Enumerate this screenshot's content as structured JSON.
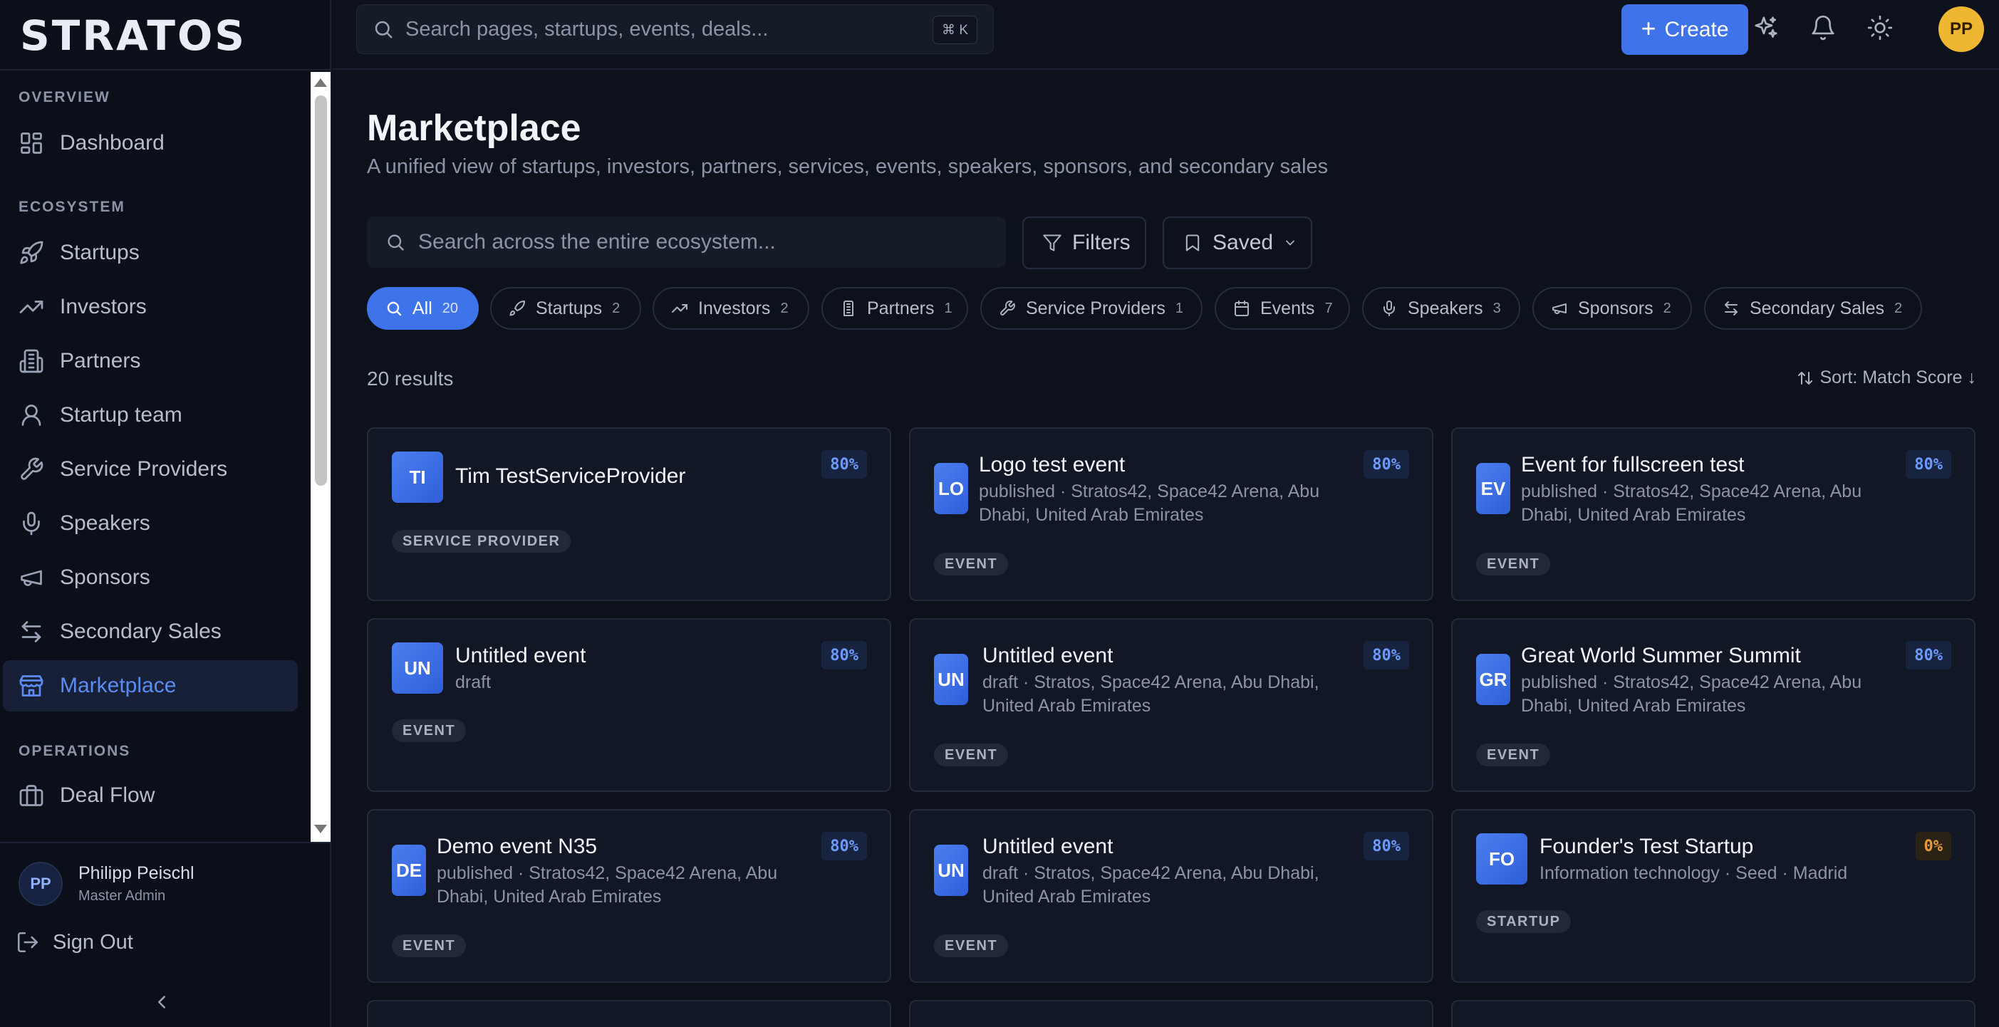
{
  "app": {
    "logo": "STRATOS"
  },
  "sidebar": {
    "sections": {
      "overview": "OVERVIEW",
      "ecosystem": "ECOSYSTEM",
      "operations": "OPERATIONS"
    },
    "items": [
      {
        "label": "Dashboard",
        "icon": "dashboard-icon"
      },
      {
        "label": "Startups",
        "icon": "rocket-icon"
      },
      {
        "label": "Investors",
        "icon": "trending-up-icon"
      },
      {
        "label": "Partners",
        "icon": "building-icon"
      },
      {
        "label": "Startup team",
        "icon": "user-icon"
      },
      {
        "label": "Service Providers",
        "icon": "wrench-icon"
      },
      {
        "label": "Speakers",
        "icon": "mic-icon"
      },
      {
        "label": "Sponsors",
        "icon": "megaphone-icon"
      },
      {
        "label": "Secondary Sales",
        "icon": "swap-icon"
      },
      {
        "label": "Marketplace",
        "icon": "store-icon",
        "active": true
      },
      {
        "label": "Deal Flow",
        "icon": "briefcase-icon"
      }
    ],
    "user": {
      "initials": "PP",
      "name": "Philipp Peischl",
      "role": "Master Admin"
    },
    "sign_out": "Sign Out"
  },
  "topbar": {
    "search_placeholder": "Search pages, startups, events, deals...",
    "shortcut": "⌘ K",
    "create_label": "Create",
    "avatar_initials": "PP"
  },
  "main": {
    "title": "Marketplace",
    "subtitle": "A unified view of startups, investors, partners, services, events, speakers, sponsors, and secondary sales",
    "search_placeholder": "Search across the entire ecosystem...",
    "filters_label": "Filters",
    "saved_label": "Saved",
    "chips": [
      {
        "label": "All",
        "count": "20",
        "active": true
      },
      {
        "label": "Startups",
        "count": "2"
      },
      {
        "label": "Investors",
        "count": "2"
      },
      {
        "label": "Partners",
        "count": "1"
      },
      {
        "label": "Service Providers",
        "count": "1"
      },
      {
        "label": "Events",
        "count": "7"
      },
      {
        "label": "Speakers",
        "count": "3"
      },
      {
        "label": "Sponsors",
        "count": "2"
      },
      {
        "label": "Secondary Sales",
        "count": "2"
      }
    ],
    "results_count": "20 results",
    "sort_label": "Sort: Match Score ↓",
    "cards": [
      {
        "initials": "TI",
        "title": "Tim TestServiceProvider",
        "meta_1": "",
        "meta_2": "",
        "score": "80%",
        "tag": "SERVICE PROVIDER"
      },
      {
        "initials": "LO",
        "title": "Logo test event",
        "meta_1": "published · Stratos42, Space42 Arena, Abu",
        "meta_2": "Dhabi, United Arab Emirates",
        "score": "80%",
        "tag": "EVENT"
      },
      {
        "initials": "EV",
        "title": "Event for fullscreen test",
        "meta_1": "published · Stratos42, Space42 Arena, Abu",
        "meta_2": "Dhabi, United Arab Emirates",
        "score": "80%",
        "tag": "EVENT"
      },
      {
        "initials": "UN",
        "title": "Untitled event",
        "meta_1": "draft",
        "meta_2": "",
        "score": "80%",
        "tag": "EVENT"
      },
      {
        "initials": "UN",
        "title": "Untitled event",
        "meta_1": "draft · Stratos, Space42 Arena, Abu Dhabi,",
        "meta_2": "United Arab Emirates",
        "score": "80%",
        "tag": "EVENT"
      },
      {
        "initials": "GR",
        "title": "Great World Summer Summit",
        "meta_1": "published · Stratos42, Space42 Arena, Abu",
        "meta_2": "Dhabi, United Arab Emirates",
        "score": "80%",
        "tag": "EVENT"
      },
      {
        "initials": "DE",
        "title": "Demo event N35",
        "meta_1": "published · Stratos42, Space42 Arena, Abu",
        "meta_2": "Dhabi, United Arab Emirates",
        "score": "80%",
        "tag": "EVENT"
      },
      {
        "initials": "UN",
        "title": "Untitled event",
        "meta_1": "draft · Stratos, Space42 Arena, Abu Dhabi,",
        "meta_2": "United Arab Emirates",
        "score": "80%",
        "tag": "EVENT"
      },
      {
        "initials": "FO",
        "title": "Founder's Test Startup",
        "meta_1": "Information technology · Seed · Madrid",
        "meta_2": "",
        "score": "0%",
        "tag": "STARTUP"
      }
    ]
  }
}
